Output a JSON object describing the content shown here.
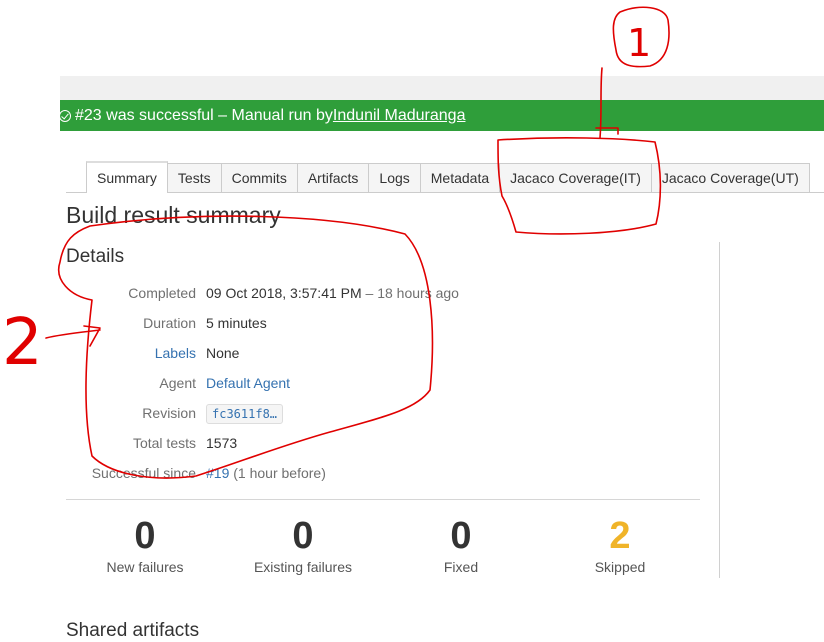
{
  "banner": {
    "status_text": "#23 was successful – Manual run by ",
    "user_link": "Indunil Maduranga",
    "color": "#2f9e3a"
  },
  "tabs": [
    {
      "label": "Summary",
      "active": true
    },
    {
      "label": "Tests"
    },
    {
      "label": "Commits"
    },
    {
      "label": "Artifacts"
    },
    {
      "label": "Logs"
    },
    {
      "label": "Metadata"
    },
    {
      "label": "Jacaco Coverage(IT)"
    },
    {
      "label": "Jacaco Coverage(UT)"
    }
  ],
  "page_title": "Build result summary",
  "details": {
    "heading": "Details",
    "completed_label": "Completed",
    "completed_value": "09 Oct 2018, 3:57:41 PM",
    "completed_ago": " – 18 hours ago",
    "duration_label": "Duration",
    "duration_value": "5 minutes",
    "labels_label": "Labels",
    "labels_value": "None",
    "agent_label": "Agent",
    "agent_value": "Default Agent",
    "revision_label": "Revision",
    "revision_value": "fc3611f8…",
    "total_tests_label": "Total tests",
    "total_tests_value": "1573",
    "successful_since_label": "Successful since",
    "successful_since_link": "#19",
    "successful_since_note": " (1 hour before)"
  },
  "stats": [
    {
      "value": "0",
      "caption": "New failures"
    },
    {
      "value": "0",
      "caption": "Existing failures"
    },
    {
      "value": "0",
      "caption": "Fixed"
    },
    {
      "value": "2",
      "caption": "Skipped",
      "color": "#f0b429"
    }
  ],
  "next_section_partial": "Shared artifacts",
  "annotations": {
    "label_1": "1",
    "label_2": "2",
    "ink_color": "#e00000"
  }
}
